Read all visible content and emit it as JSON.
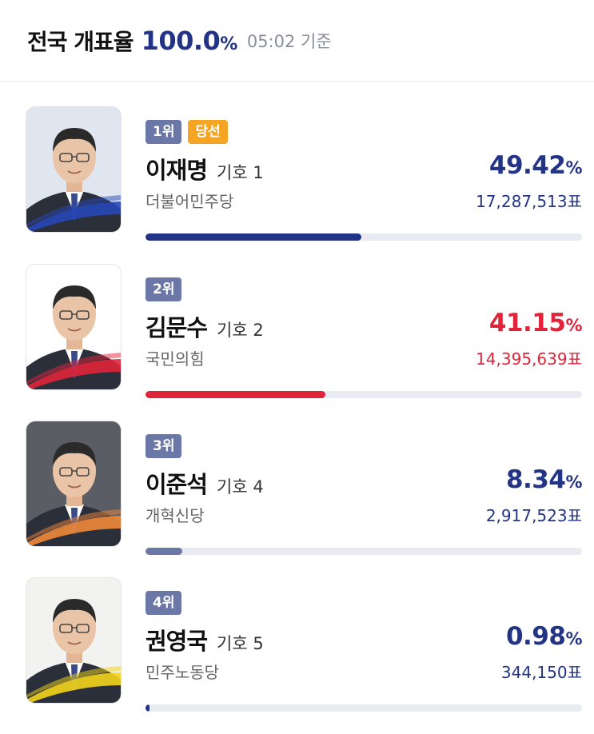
{
  "header": {
    "title": "전국 개표율",
    "rate": "100.0",
    "rate_unit": "%",
    "time": "05:02 기준"
  },
  "candidates": [
    {
      "rank": "1위",
      "win_badge": "당선",
      "name": "이재명",
      "number": "기호 1",
      "party": "더불어민주당",
      "percent": "49.42",
      "percent_unit": "%",
      "votes": "17,287,513표",
      "share": 0.4942,
      "color": "#233486",
      "bar_color": "#233486",
      "ribbon_color": "#2747b8",
      "bg_color": "#dfe6ef"
    },
    {
      "rank": "2위",
      "win_badge": "",
      "name": "김문수",
      "number": "기호 2",
      "party": "국민의힘",
      "percent": "41.15",
      "percent_unit": "%",
      "votes": "14,395,639표",
      "share": 0.4115,
      "color": "#e0253a",
      "bar_color": "#e0253a",
      "ribbon_color": "#e0253a",
      "bg_color": "#ffffff"
    },
    {
      "rank": "3위",
      "win_badge": "",
      "name": "이준석",
      "number": "기호 4",
      "party": "개혁신당",
      "percent": "8.34",
      "percent_unit": "%",
      "votes": "2,917,523표",
      "share": 0.0834,
      "color": "#233486",
      "bar_color": "#6b77a6",
      "ribbon_color": "#f0883a",
      "bg_color": "#5b5d64"
    },
    {
      "rank": "4위",
      "win_badge": "",
      "name": "권영국",
      "number": "기호 5",
      "party": "민주노동당",
      "percent": "0.98",
      "percent_unit": "%",
      "votes": "344,150표",
      "share": 0.0098,
      "color": "#233486",
      "bar_color": "#233486",
      "ribbon_color": "#f2d51a",
      "bg_color": "#f2f2f0"
    }
  ]
}
